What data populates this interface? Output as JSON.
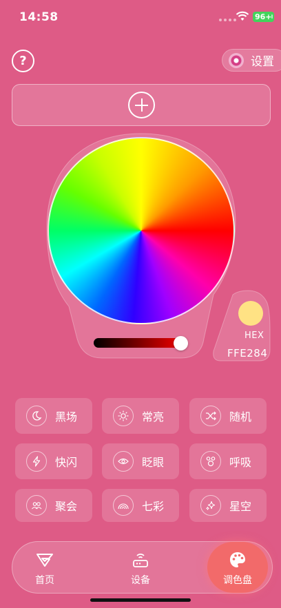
{
  "status": {
    "time": "14:58",
    "battery": "96+"
  },
  "header": {
    "help_glyph": "?",
    "settings_label": "设置"
  },
  "colors": {
    "background": "#de5b86",
    "accent_active": "#f26a6a",
    "selected": "#ffe284"
  },
  "hex": {
    "label": "HEX",
    "value": "FFE284"
  },
  "brightness": {
    "level": 0.93
  },
  "modes": [
    {
      "label": "黑场",
      "icon": "moon-icon"
    },
    {
      "label": "常亮",
      "icon": "sun-icon"
    },
    {
      "label": "随机",
      "icon": "shuffle-icon"
    },
    {
      "label": "快闪",
      "icon": "flash-icon"
    },
    {
      "label": "眨眼",
      "icon": "eye-icon"
    },
    {
      "label": "呼吸",
      "icon": "breath-icon"
    },
    {
      "label": "聚会",
      "icon": "people-icon"
    },
    {
      "label": "七彩",
      "icon": "rainbow-icon"
    },
    {
      "label": "星空",
      "icon": "sparkle-icon"
    }
  ],
  "tabs": [
    {
      "label": "首页",
      "icon": "home-logo-icon"
    },
    {
      "label": "设备",
      "icon": "router-icon"
    },
    {
      "label": "调色盘",
      "icon": "palette-icon",
      "active": true
    }
  ]
}
